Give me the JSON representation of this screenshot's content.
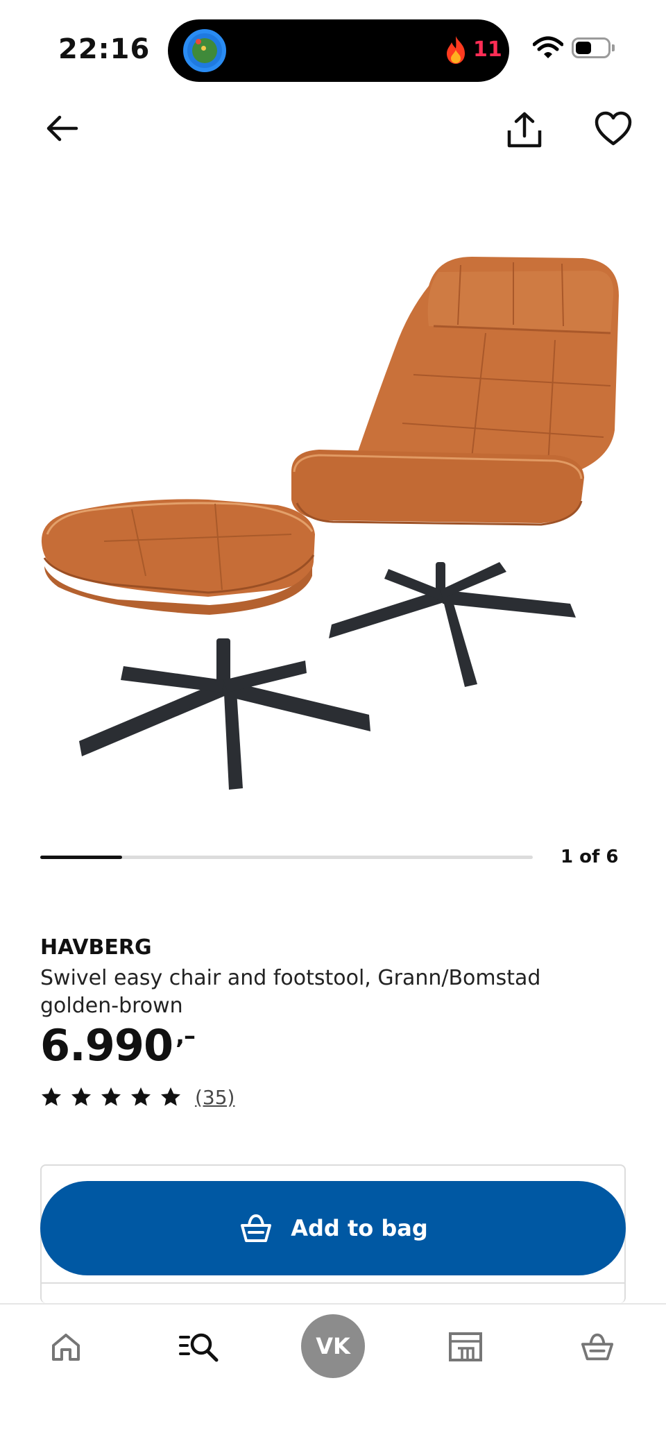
{
  "status_bar": {
    "time": "22:16",
    "streak_count": "11"
  },
  "header": {
    "back_icon": "arrow-left-icon",
    "share_icon": "share-icon",
    "favorite_icon": "heart-icon"
  },
  "product": {
    "image_alt": "swivel easy chair and footstool",
    "carousel": {
      "label": "1 of 6",
      "current": 1,
      "total": 6
    },
    "brand": "HAVBERG",
    "description": "Swivel easy chair and footstool, Grann/Bomstad golden-brown",
    "price": "6.990",
    "price_suffix": ",–",
    "rating": {
      "stars": 5,
      "review_count": "(35)"
    }
  },
  "actions": {
    "add_to_bag_label": "Add to bag"
  },
  "tab_bar": {
    "home_icon": "home-icon",
    "search_icon": "search-icon",
    "profile_initials": "VK",
    "stores_icon": "store-icon",
    "bag_icon": "basket-icon"
  },
  "colors": {
    "primary": "#0058a3",
    "leather": "#c9713a",
    "streak": "#ff2d55",
    "avatar": "#8c8c8c"
  }
}
